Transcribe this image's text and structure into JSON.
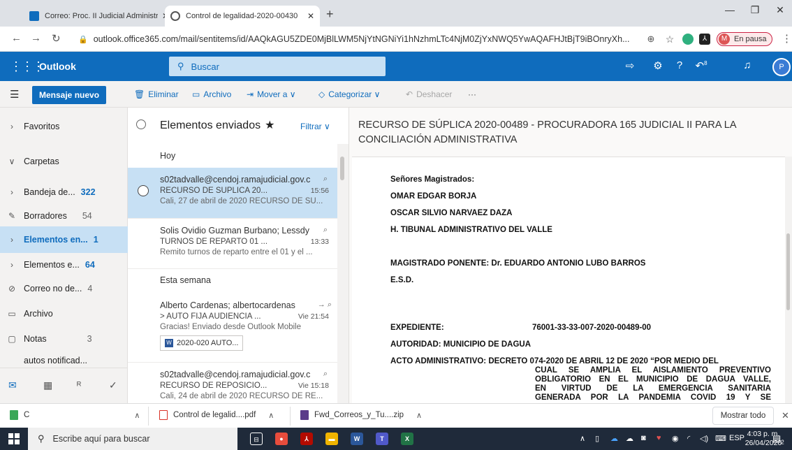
{
  "browser": {
    "tabs": [
      {
        "title": "Correo: Proc. II Judicial Administr",
        "active": false
      },
      {
        "title": "Control de legalidad-2020-00430",
        "active": true
      }
    ],
    "url": "outlook.office365.com/mail/sentitems/id/AAQkAGU5ZDE0MjBlLWM5NjYtNGNiYi1hNzhmLTc4NjM0ZjYxNWQ5YwAQAFHJtBjT9iBOnryXh...",
    "profile_initial": "M",
    "profile_status": "En pausa"
  },
  "outlook": {
    "brand": "Outlook",
    "search_placeholder": "Buscar",
    "notif_count": "8",
    "avatar_initial": "P"
  },
  "commands": {
    "new_mail": "Mensaje nuevo",
    "delete": "Eliminar",
    "archive": "Archivo",
    "move": "Mover a",
    "categorize": "Categorizar",
    "undo": "Deshacer",
    "more": "···"
  },
  "nav": {
    "favorites": "Favoritos",
    "folders": "Carpetas",
    "items": [
      {
        "label": "Bandeja de...",
        "count": "322",
        "icon": "chevron-right-icon"
      },
      {
        "label": "Borradores",
        "count": "54",
        "icon": "pencil-icon"
      },
      {
        "label": "Elementos en...",
        "count": "1",
        "icon": "chevron-right-icon"
      },
      {
        "label": "Elementos e...",
        "count": "64",
        "icon": "chevron-right-icon"
      },
      {
        "label": "Correo no de...",
        "count": "4",
        "icon": "blocked-icon"
      },
      {
        "label": "Archivo",
        "count": "",
        "icon": "archive-icon"
      },
      {
        "label": "Notas",
        "count": "3",
        "icon": "note-icon"
      },
      {
        "label": "autos notificad...",
        "count": "",
        "icon": ""
      }
    ]
  },
  "list": {
    "title": "Elementos enviados",
    "filter": "Filtrar",
    "group_today": "Hoy",
    "group_week": "Esta semana",
    "messages": [
      {
        "from": "s02tadvalle@cendoj.ramajudicial.gov.c",
        "subject": "RECURSO DE SÚPLICA 20...",
        "time": "15:56",
        "preview": "Cali, 27 de abril de 2020 RECURSO DE SÚ..."
      },
      {
        "from": "Solis Ovidio Guzman Burbano; Lessdy",
        "subject": "TURNOS DE REPARTO 01 ...",
        "time": "13:33",
        "preview": "Remito turnos de reparto entre el 01 y el ..."
      },
      {
        "from": "Alberto Cardenas; albertocardenas",
        "subject": "> AUTO FIJA AUDIENCIA ...",
        "time": "Vie 21:54",
        "preview": "Gracias! Enviado desde Outlook Mobile",
        "attachment": "2020-020 AUTO..."
      },
      {
        "from": "s02tadvalle@cendoj.ramajudicial.gov.c",
        "subject": "RECURSO DE REPOSICIÓ...",
        "time": "Vie 15:18",
        "preview": "Cali, 24 de abril de 2020 RECURSO DE RE..."
      }
    ]
  },
  "reading": {
    "subject": "RECURSO DE SÚPLICA 2020-00489 - PROCURADORA 165 JUDICIAL II PARA LA CONCILIACIÓN ADMINISTRATIVA",
    "greeting": "Señores Magistrados:",
    "name1": "OMAR EDGAR BORJA",
    "name2": "OSCAR SILVIO NARVAEZ DAZA",
    "tribunal": "H. TIBUNAL ADMINISTRATIVO DEL VALLE",
    "ponente": "MAGISTRADO PONENTE: Dr. EDUARDO ANTONIO LUBO BARROS",
    "esd": "E.S.D.",
    "expediente_label": "EXPEDIENTE:",
    "expediente_value": "76001-33-33-007-2020-00489-00",
    "autoridad": "AUTORIDAD: MUNICIPIO DE DAGUA",
    "acto_label": "ACTO ADMINISTRATIVO: DECRETO 074-2020 DE ABRIL 12 DE 2020 “POR MEDIO DEL",
    "acto_lines": [
      "CUAL SE AMPLIA EL AISLAMIENTO PREVENTIVO",
      "OBLIGATORIO EN EL MUNICIPIO DE DAGUA VALLE,",
      "EN VIRTUD DE LA EMERGENCIA SANITARIA",
      "GENERADA POR LA PANDEMIA COVID 19 Y SE"
    ]
  },
  "downloads": {
    "partial": "C",
    "items": [
      "Control de legalid....pdf",
      "Fwd_Correos_y_Tu....zip"
    ],
    "show_all": "Mostrar todo"
  },
  "taskbar": {
    "search": "Escribe aquí para buscar",
    "lang": "ESP",
    "time": "4:03 p. m.",
    "date": "26/04/2020",
    "notif_badge": "2"
  }
}
